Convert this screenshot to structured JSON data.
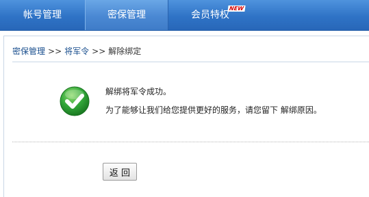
{
  "nav": {
    "tabs": [
      {
        "label": "帐号管理"
      },
      {
        "label": "密保管理"
      },
      {
        "label": "会员特权"
      }
    ],
    "badge": "NEW"
  },
  "breadcrumb": {
    "items": [
      "密保管理",
      "将军令",
      "解除绑定"
    ],
    "separator": ">>"
  },
  "message": {
    "line1": "解绑将军令成功。",
    "line2": "为了能够让我们给您提供更好的服务，请您留下 解绑原因。"
  },
  "actions": {
    "back_label": "返 回"
  },
  "colors": {
    "nav_bg": "#2f73c6",
    "nav_active": "#4a88d3",
    "success_green": "#33a83a",
    "link": "#1a4f8e"
  }
}
